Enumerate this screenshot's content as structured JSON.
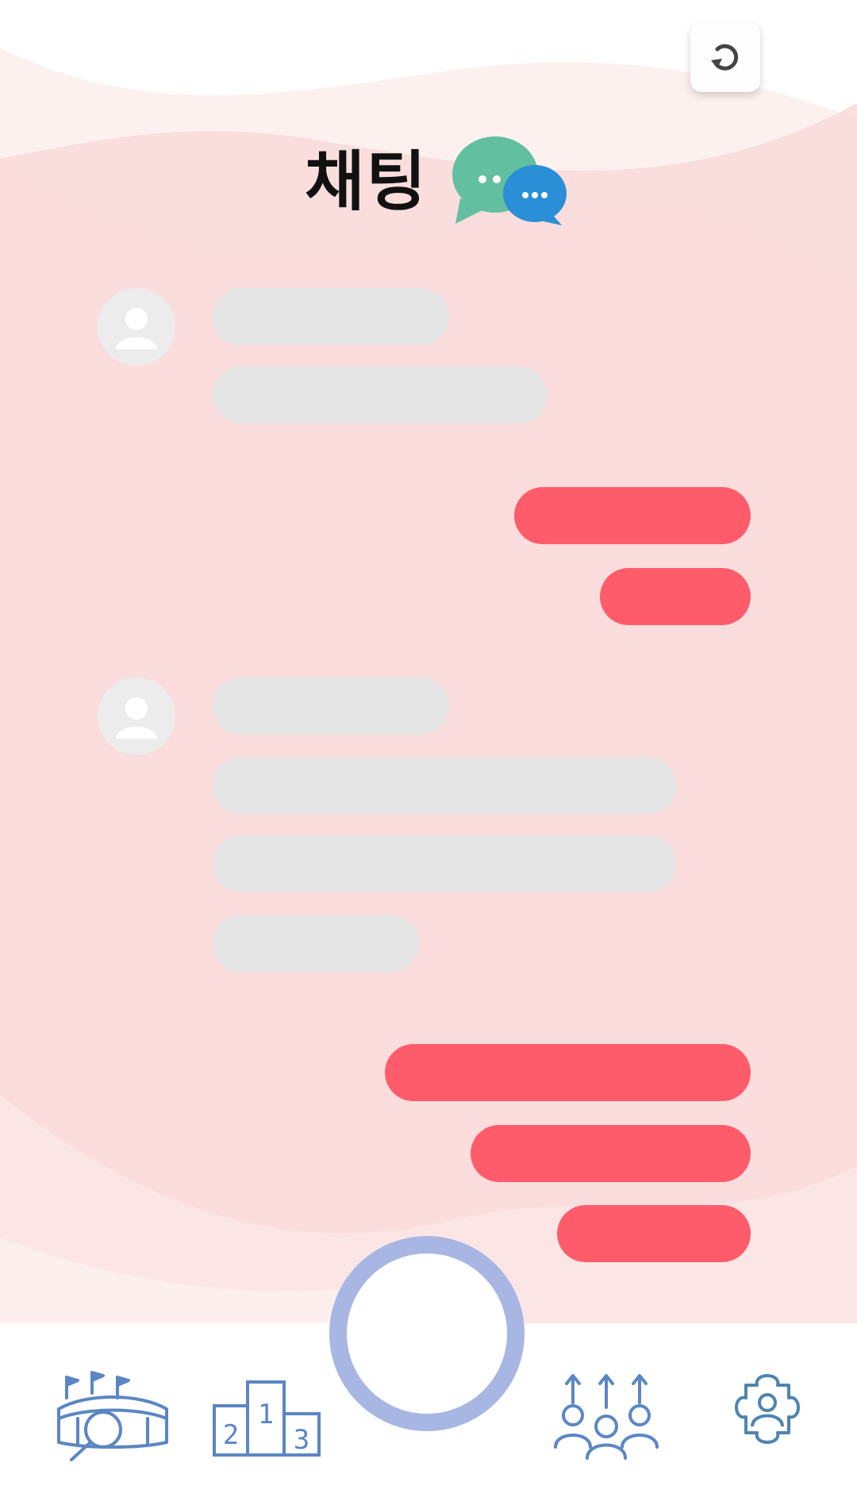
{
  "header": {
    "title": "채팅"
  },
  "icons": {
    "refresh": "refresh-icon",
    "chat": "chat-bubbles-icon",
    "avatar": "user-avatar-icon",
    "nav": [
      "stadium-search-icon",
      "podium-ranking-icon",
      "center-ring-button",
      "people-growth-icon",
      "puzzle-team-icon"
    ]
  },
  "colors": {
    "incoming_bubble": "#e6e6e6",
    "outgoing_bubble": "#ff5c6b",
    "background_pink": "#fbdcdc",
    "nav_icon": "#5b86c4",
    "center_ring": "#a8b6e3"
  },
  "messages": [
    {
      "side": "incoming",
      "lines": 2
    },
    {
      "side": "outgoing",
      "lines": 2
    },
    {
      "side": "incoming",
      "lines": 4
    },
    {
      "side": "outgoing",
      "lines": 3
    }
  ],
  "bottom_nav": {
    "items": [
      {
        "icon": "stadium-search-icon"
      },
      {
        "icon": "podium-ranking-icon",
        "podium_numbers": [
          "2",
          "1",
          "3"
        ]
      },
      {
        "icon": "center-ring-button"
      },
      {
        "icon": "people-growth-icon"
      },
      {
        "icon": "puzzle-team-icon"
      }
    ]
  }
}
